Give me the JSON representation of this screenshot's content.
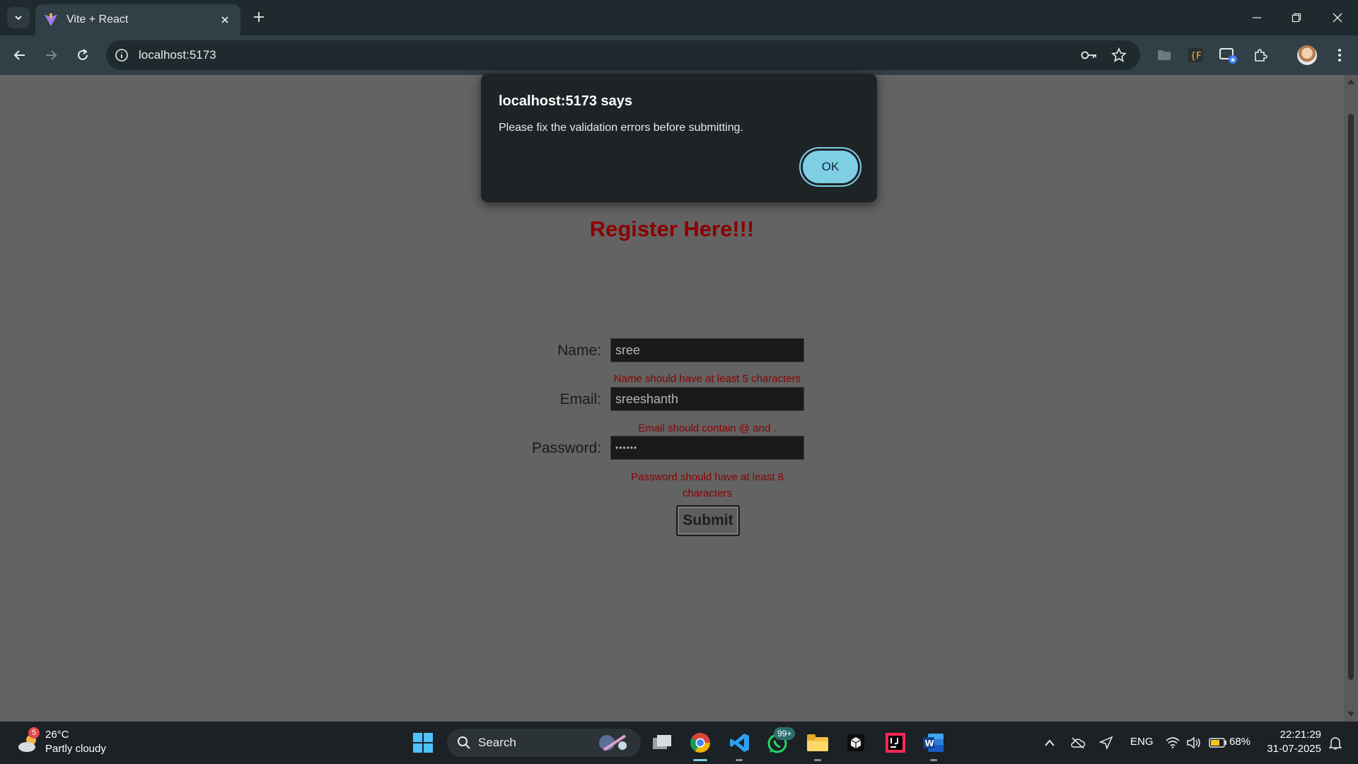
{
  "browser": {
    "tab_title": "Vite + React",
    "url": "localhost:5173"
  },
  "dialog": {
    "title": "localhost:5173 says",
    "message": "Please fix the validation errors before submitting.",
    "ok_label": "OK"
  },
  "form": {
    "title": "Register Here!!!",
    "name_label": "Name:",
    "name_value": "sree",
    "name_error": "Name should have at least 5 characters",
    "email_label": "Email:",
    "email_value": "sreeshanth",
    "email_error": "Email should contain @ and .",
    "password_label": "Password:",
    "password_value": "••••••",
    "password_error_line1": "Password should have at least 8",
    "password_error_line2": "characters",
    "submit_label": "Submit"
  },
  "taskbar": {
    "weather_badge": "5",
    "weather_temp": "26°C",
    "weather_desc": "Partly cloudy",
    "search_label": "Search",
    "whatsapp_badge": "99+",
    "language": "ENG",
    "battery": "68%",
    "time": "22:21:29",
    "date": "31-07-2025"
  },
  "colors": {
    "title_red": "#8b0000",
    "ok_button": "#7fcfe4",
    "chrome_dark": "#1f2a2f"
  }
}
